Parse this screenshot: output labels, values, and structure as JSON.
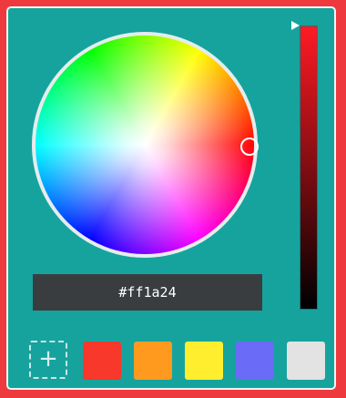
{
  "picker": {
    "hex_value": "#ff1a24",
    "selected_color": "#ff1a24",
    "add_glyph": "+",
    "swatches": [
      {
        "name": "red",
        "color": "#f7382b"
      },
      {
        "name": "orange",
        "color": "#ff9a1f"
      },
      {
        "name": "yellow",
        "color": "#ffee2e"
      },
      {
        "name": "periwinkle",
        "color": "#6a6bf6"
      },
      {
        "name": "light-gray",
        "color": "#e3e3e3"
      }
    ]
  }
}
